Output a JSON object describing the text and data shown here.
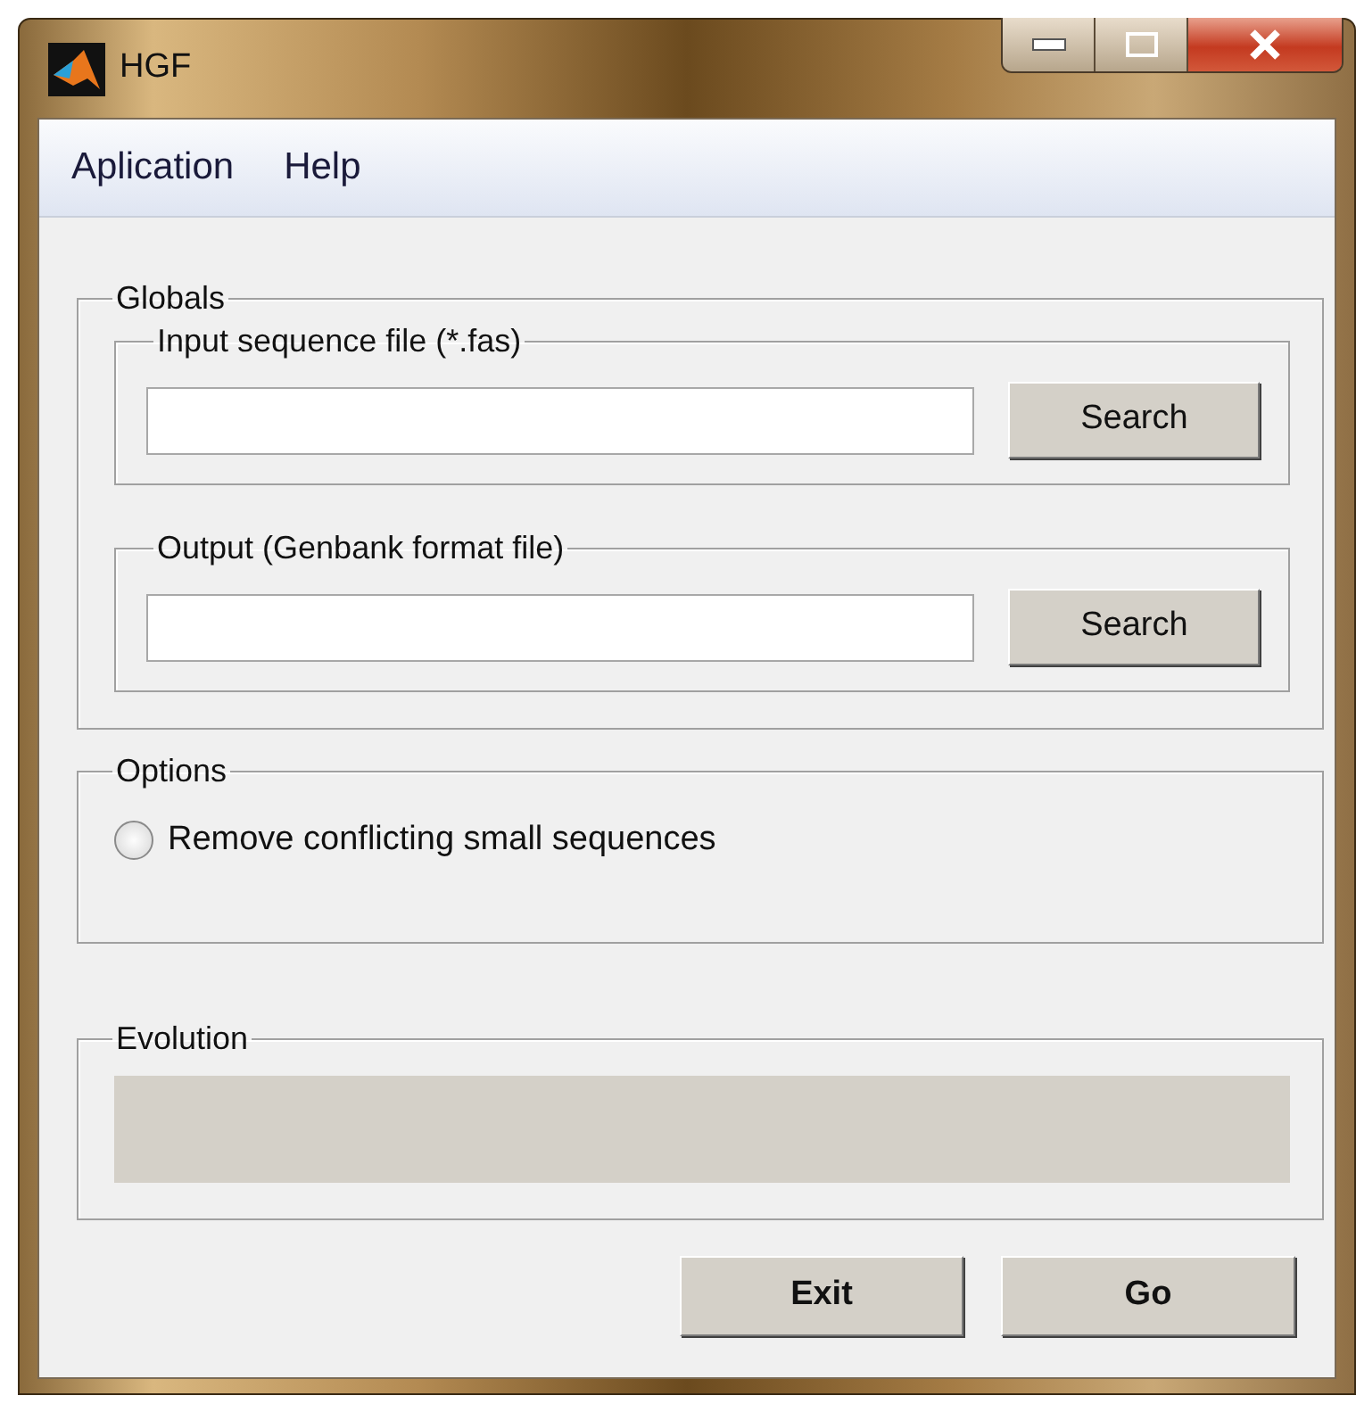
{
  "window": {
    "title": "HGF"
  },
  "menu": [
    {
      "label": "Aplication"
    },
    {
      "label": "Help"
    }
  ],
  "globals": {
    "title": "Globals",
    "groups": [
      {
        "title": "Input sequence file (*.fas)",
        "button": "Search"
      },
      {
        "title": "Output (Genbank format file)",
        "button": "Search"
      }
    ]
  },
  "options": {
    "title": "Options",
    "items": [
      {
        "label": "Remove conflicting small sequences",
        "checked": false
      }
    ]
  },
  "evolution": {
    "title": "Evolution",
    "level": 0
  },
  "buttons": [
    {
      "label": "Exit"
    },
    {
      "label": "Go"
    }
  ]
}
